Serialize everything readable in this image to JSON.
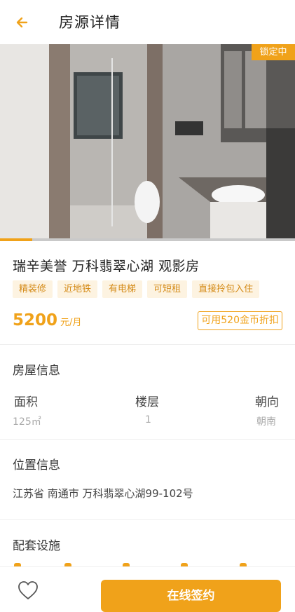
{
  "header": {
    "title": "房源详情",
    "back_icon": "arrow-left-icon",
    "accent": "#f0a21a"
  },
  "hero": {
    "badge": "锁定中",
    "image_desc_icon": "bathroom-photo",
    "slide_progress": 0.11
  },
  "listing": {
    "title": "瑞辛美誉 万科翡翠心湖 观影房",
    "tags": [
      "精装修",
      "近地铁",
      "有电梯",
      "可短租",
      "直接拎包入住"
    ],
    "price": "5200",
    "price_unit": "元/月",
    "coin_offer": "可用520金币折扣"
  },
  "house_info": {
    "title": "房屋信息",
    "columns": [
      {
        "label": "面积",
        "value": "125㎡"
      },
      {
        "label": "楼层",
        "value": "1"
      },
      {
        "label": "朝向",
        "value": "朝南"
      }
    ]
  },
  "location": {
    "title": "位置信息",
    "address": "江苏省 南通市 万科翡翠心湖99-102号"
  },
  "facilities": {
    "title": "配套设施"
  },
  "footer": {
    "favorite_icon": "heart-outline-icon",
    "sign_label": "在线签约"
  }
}
